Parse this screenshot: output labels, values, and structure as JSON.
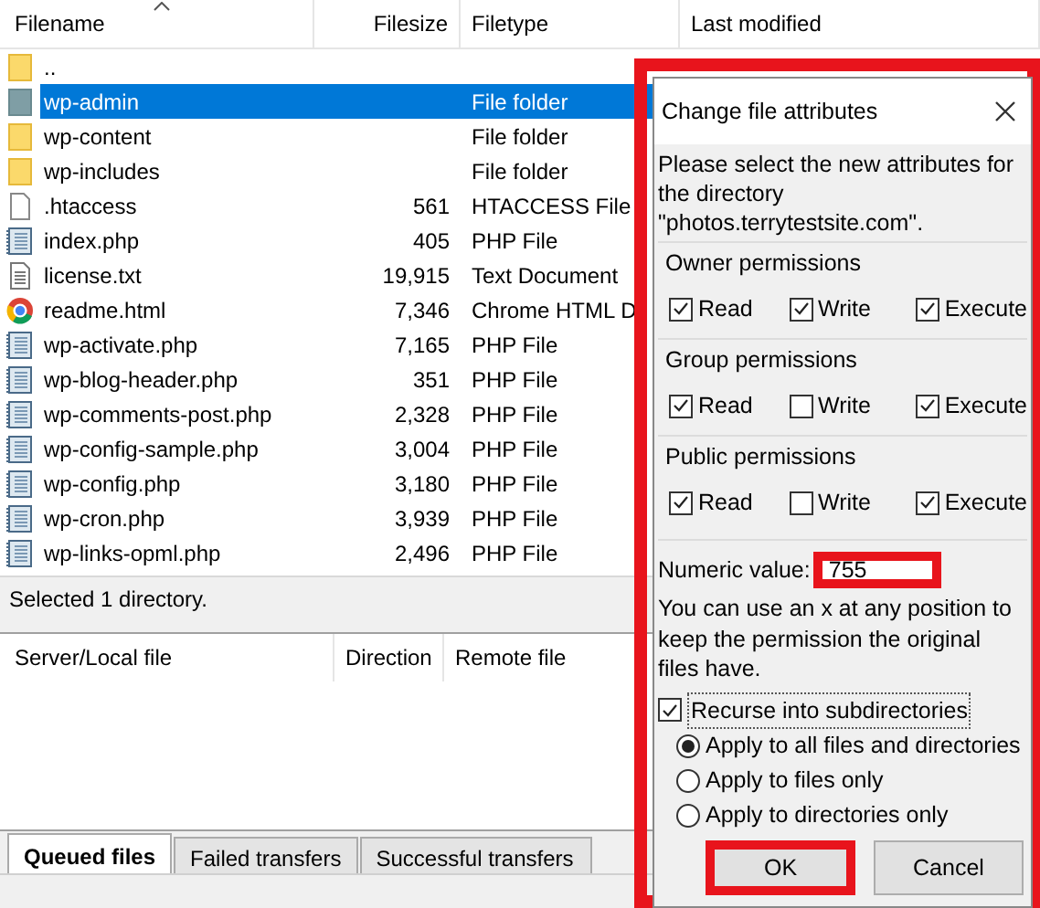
{
  "file_list": {
    "columns": [
      "Filename",
      "Filesize",
      "Filetype",
      "Last modified"
    ],
    "rows": [
      {
        "name": "..",
        "kind": "folder",
        "selected": false
      },
      {
        "name": "wp-admin",
        "type": "File folder",
        "kind": "folder",
        "selected": true
      },
      {
        "name": "wp-content",
        "type": "File folder",
        "kind": "folder",
        "selected": false
      },
      {
        "name": "wp-includes",
        "type": "File folder",
        "kind": "folder",
        "selected": false
      },
      {
        "name": ".htaccess",
        "size": "561",
        "type": "HTACCESS File",
        "kind": "blank",
        "selected": false
      },
      {
        "name": "index.php",
        "size": "405",
        "type": "PHP File",
        "kind": "script",
        "selected": false
      },
      {
        "name": "license.txt",
        "size": "19,915",
        "type": "Text Document",
        "kind": "text",
        "selected": false
      },
      {
        "name": "readme.html",
        "size": "7,346",
        "type": "Chrome HTML D",
        "kind": "browser",
        "selected": false
      },
      {
        "name": "wp-activate.php",
        "size": "7,165",
        "type": "PHP File",
        "kind": "script",
        "selected": false
      },
      {
        "name": "wp-blog-header.php",
        "size": "351",
        "type": "PHP File",
        "kind": "script",
        "selected": false
      },
      {
        "name": "wp-comments-post.php",
        "size": "2,328",
        "type": "PHP File",
        "kind": "script",
        "selected": false
      },
      {
        "name": "wp-config-sample.php",
        "size": "3,004",
        "type": "PHP File",
        "kind": "script",
        "selected": false
      },
      {
        "name": "wp-config.php",
        "size": "3,180",
        "type": "PHP File",
        "kind": "script",
        "selected": false
      },
      {
        "name": "wp-cron.php",
        "size": "3,939",
        "type": "PHP File",
        "kind": "script",
        "selected": false
      },
      {
        "name": "wp-links-opml.php",
        "size": "2,496",
        "type": "PHP File",
        "kind": "script",
        "selected": false
      }
    ]
  },
  "status": "Selected 1 directory.",
  "queue": {
    "columns": [
      "Server/Local file",
      "Direction",
      "Remote file"
    ],
    "tabs": [
      {
        "label": "Queued files",
        "selected": true
      },
      {
        "label": "Failed transfers",
        "selected": false
      },
      {
        "label": "Successful transfers",
        "selected": false
      }
    ]
  },
  "dialog": {
    "title": "Change file attributes",
    "highlighted": true,
    "intro": "Please select the new attributes for the directory \"photos.terrytestsite.com\".",
    "groups": [
      {
        "title": "Owner permissions",
        "options": [
          {
            "label": "Read",
            "checked": true
          },
          {
            "label": "Write",
            "checked": true
          },
          {
            "label": "Execute",
            "checked": true
          }
        ]
      },
      {
        "title": "Group permissions",
        "options": [
          {
            "label": "Read",
            "checked": true
          },
          {
            "label": "Write",
            "checked": false
          },
          {
            "label": "Execute",
            "checked": true
          }
        ]
      },
      {
        "title": "Public permissions",
        "options": [
          {
            "label": "Read",
            "checked": true
          },
          {
            "label": "Write",
            "checked": false
          },
          {
            "label": "Execute",
            "checked": true
          }
        ]
      }
    ],
    "numeric": {
      "label": "Numeric value:",
      "value": "755",
      "highlighted": true
    },
    "hint": "You can use an x at any position to keep the permission the original files have.",
    "recurse": {
      "label": "Recurse into subdirectories",
      "checked": true
    },
    "apply_options": [
      {
        "label": "Apply to all files and directories",
        "selected": true
      },
      {
        "label": "Apply to files only",
        "selected": false
      },
      {
        "label": "Apply to directories only",
        "selected": false
      }
    ],
    "buttons": [
      {
        "label": "OK",
        "highlighted": true
      },
      {
        "label": "Cancel",
        "highlighted": false
      }
    ]
  }
}
